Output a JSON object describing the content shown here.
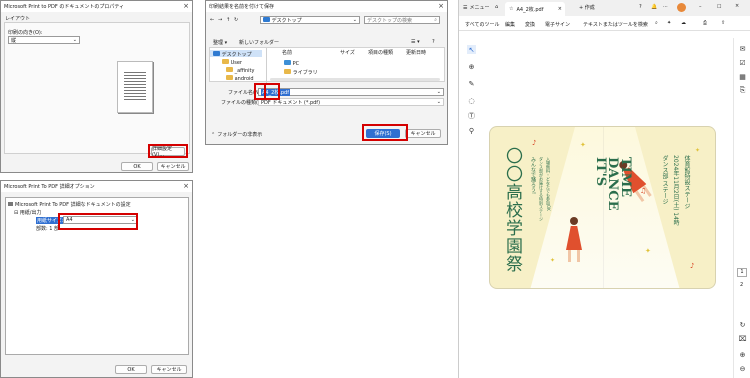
{
  "props_dialog": {
    "title": "Microsoft Print to PDF のドキュメントのプロパティ",
    "tab_layout": "レイアウト",
    "orientation_label": "印刷の向き(O):",
    "orientation_value": "縦",
    "advanced_button": "詳細設定(V)...",
    "ok_button": "OK",
    "cancel_button": "キャンセル"
  },
  "advanced_dialog": {
    "title": "Microsoft Print To PDF 詳細オプション",
    "tree_root": "Microsoft Print To PDF 詳細なドキュメントの設定",
    "tree_paper_output": "用紙/出力",
    "paper_size_label": "用紙サイズ:",
    "paper_size_value": "A4",
    "copies_label": "部数: 1 部",
    "ok_button": "OK",
    "cancel_button": "キャンセル"
  },
  "save_dialog": {
    "title": "印刷結果を名前を付けて保存",
    "breadcrumb": "デスクトップ",
    "search_placeholder": "デスクトップの検索",
    "organize": "整理 ▾",
    "new_folder": "新しいフォルダー",
    "nav_items": [
      "デスクトップ",
      "User",
      "_affinity",
      "android"
    ],
    "col_name": "名前",
    "col_size": "サイズ",
    "col_type": "項目の種類",
    "col_date": "更新日時",
    "files": [
      "PC",
      "ライブラリ"
    ],
    "filename_label": "ファイル名(N):",
    "filename_value": "A4_2枚.pdf",
    "filetype_label": "ファイルの種類(T):",
    "filetype_value": "PDF ドキュメント (*.pdf)",
    "hide_folders": "フォルダーの非表示",
    "save_button": "保存(S)",
    "cancel_button": "キャンセル"
  },
  "pdf_viewer": {
    "menu": "メニュー",
    "tab_title": "A4_2枚.pdf",
    "create": "+ 作成",
    "toolbar": [
      "すべてのツール",
      "編集",
      "変換",
      "電子サイン"
    ],
    "search_tools": "テキストまたはツールを検索",
    "page_current": "1",
    "page_total": "2",
    "poster": {
      "school": "〇〇高校学園祭",
      "title_en_1": "IT'S",
      "title_en_2": "DANCE",
      "title_en_3": "TIME",
      "right_1": "ダンス部 ステージ",
      "right_2": "2024年11月2日(土) 14時",
      "right_3": "体育館特設ステージ",
      "left_1": "みんなで踊ろう!",
      "left_2": "ダンス部がお届けする特別ステージ",
      "left_3": "入場無料・どなたでも参加OK"
    }
  },
  "colors": {
    "accent": "#d40000",
    "select": "#2f6fd1",
    "poster_bg": "#f7f0c7",
    "poster_ink": "#2b6e4c"
  }
}
